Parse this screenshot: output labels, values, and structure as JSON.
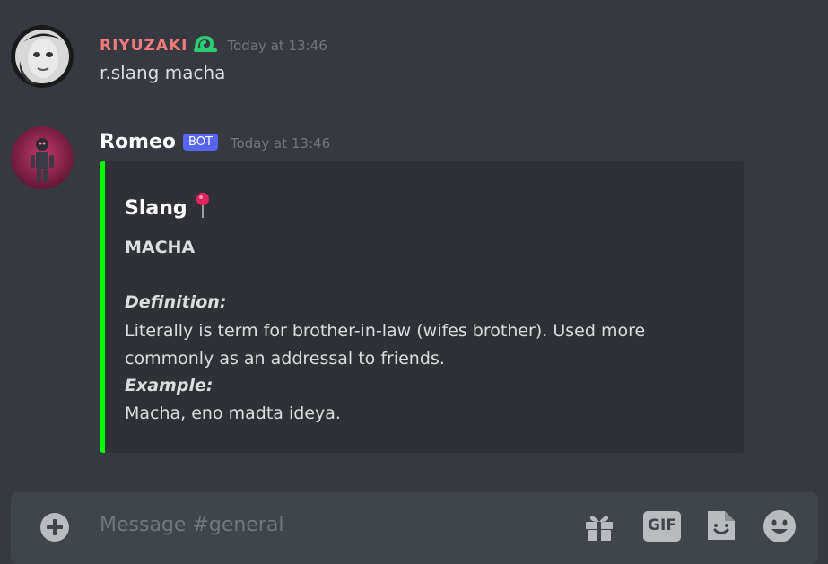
{
  "messages": [
    {
      "username": "RIYUZAKI",
      "username_color": "#f47b7b",
      "timestamp": "Today at 13:46",
      "content": "r.slang macha"
    },
    {
      "username": "Romeo",
      "username_color": "#ffffff",
      "bot_tag": "BOT",
      "timestamp": "Today at 13:46",
      "embed": {
        "accent_color": "#00ff00",
        "title": "Slang",
        "title_icon": "round-pushpin-icon",
        "word": "MACHA",
        "definition_label": "Definition:",
        "definition": "Literally is term for brother-in-law (wifes brother). Used more commonly as an addressal to friends.",
        "example_label": "Example:",
        "example": "Macha, eno madta ideya."
      }
    }
  ],
  "composer": {
    "placeholder": "Message #general",
    "buttons": {
      "add": "plus-circle-icon",
      "gift": "gift-icon",
      "gif_label": "GIF",
      "sticker": "sticker-icon",
      "emoji": "emoji-icon"
    }
  },
  "colors": {
    "background": "#36393f",
    "embed_bg": "#2f3136",
    "bot_tag": "#5865f2",
    "composer_bg": "#40444b"
  }
}
